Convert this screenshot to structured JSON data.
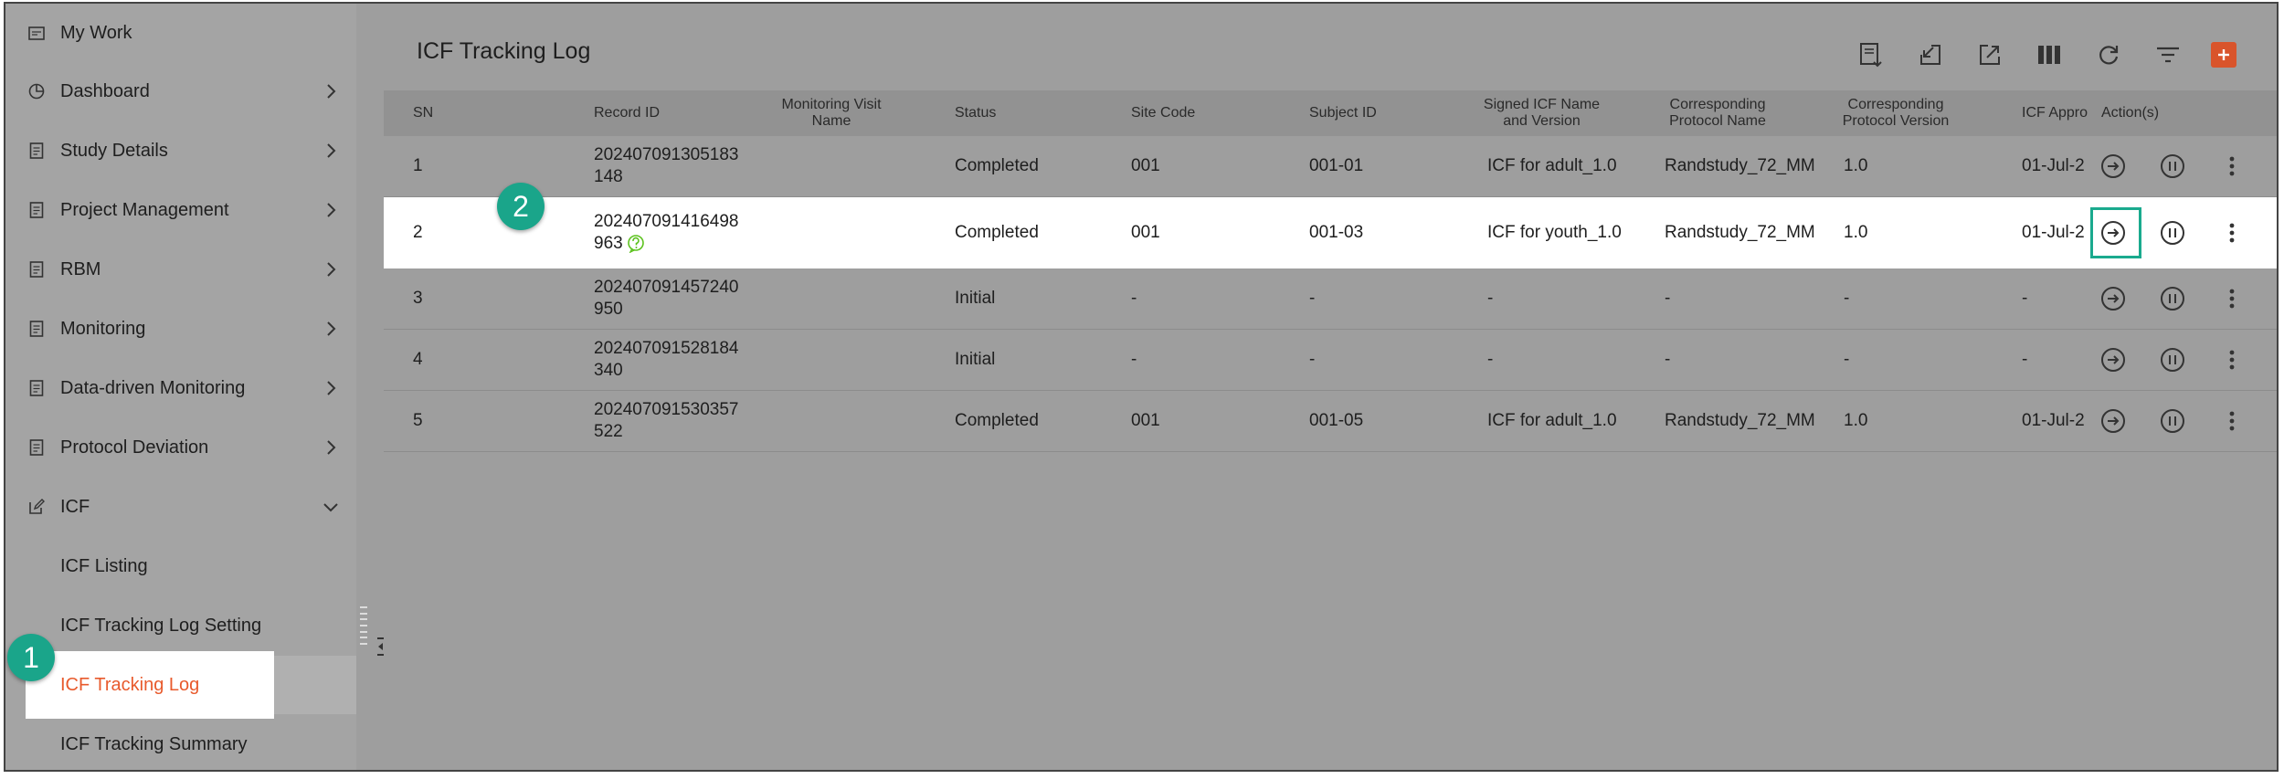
{
  "sidebar": {
    "items": [
      {
        "label": "My Work",
        "icon": "calendar-icon",
        "chevron": false
      },
      {
        "label": "Dashboard",
        "icon": "pie-chart-icon",
        "chevron": true
      },
      {
        "label": "Study Details",
        "icon": "document-icon",
        "chevron": true
      },
      {
        "label": "Project Management",
        "icon": "document-icon",
        "chevron": true
      },
      {
        "label": "RBM",
        "icon": "document-icon",
        "chevron": true
      },
      {
        "label": "Monitoring",
        "icon": "document-icon",
        "chevron": true
      },
      {
        "label": "Data-driven Monitoring",
        "icon": "document-icon",
        "chevron": true
      },
      {
        "label": "Protocol Deviation",
        "icon": "document-icon",
        "chevron": true
      },
      {
        "label": "ICF",
        "icon": "edit-icon",
        "chevron": true,
        "expanded": true
      }
    ],
    "sub_items": [
      {
        "label": "ICF Listing"
      },
      {
        "label": "ICF Tracking Log Setting"
      },
      {
        "label": "ICF Tracking Log",
        "active": true
      },
      {
        "label": "ICF Tracking Summary"
      }
    ]
  },
  "page": {
    "title": "ICF Tracking Log"
  },
  "toolbar": {
    "icons": [
      "export-list-icon",
      "import-icon",
      "external-link-icon",
      "columns-icon",
      "refresh-icon",
      "filter-icon",
      "add-icon"
    ]
  },
  "table": {
    "columns": [
      "SN",
      "Record ID",
      "Monitoring Visit Name",
      "Status",
      "Site Code",
      "Subject ID",
      "Signed ICF Name and Version",
      "Corresponding Protocol Name",
      "Corresponding Protocol Version",
      "ICF Appro",
      "Action(s)"
    ],
    "rows": [
      {
        "sn": "1",
        "record_id": "202407091305183148",
        "record_id_l1": "202407091305183",
        "record_id_l2": "148",
        "visit": "",
        "status": "Completed",
        "site": "001",
        "subject": "001-01",
        "icf": "ICF for adult_1.0",
        "protocol": "Randstudy_72_MM",
        "version": "1.0",
        "approval": "01-Jul-2"
      },
      {
        "sn": "2",
        "record_id": "202407091416498963",
        "record_id_l1": "202407091416498",
        "record_id_l2": "963",
        "visit": "",
        "status": "Completed",
        "site": "001",
        "subject": "001-03",
        "icf": "ICF for youth_1.0",
        "protocol": "Randstudy_72_MM",
        "version": "1.0",
        "approval": "01-Jul-2"
      },
      {
        "sn": "3",
        "record_id": "202407091457240950",
        "record_id_l1": "202407091457240",
        "record_id_l2": "950",
        "visit": "",
        "status": "Initial",
        "site": "-",
        "subject": "-",
        "icf": "-",
        "protocol": "-",
        "version": "-",
        "approval": "-"
      },
      {
        "sn": "4",
        "record_id": "202407091528184340",
        "record_id_l1": "202407091528184",
        "record_id_l2": "340",
        "visit": "",
        "status": "Initial",
        "site": "-",
        "subject": "-",
        "icf": "-",
        "protocol": "-",
        "version": "-",
        "approval": "-"
      },
      {
        "sn": "5",
        "record_id": "202407091530357522",
        "record_id_l1": "202407091530357",
        "record_id_l2": "522",
        "visit": "",
        "status": "Completed",
        "site": "001",
        "subject": "001-05",
        "icf": "ICF for adult_1.0",
        "protocol": "Randstudy_72_MM",
        "version": "1.0",
        "approval": "01-Jul-2"
      }
    ]
  },
  "callouts": {
    "one": "1",
    "two": "2"
  },
  "colors": {
    "accent": "#e85a2c",
    "callout": "#1aa58a",
    "highlight_border": "#1aaa8e"
  }
}
